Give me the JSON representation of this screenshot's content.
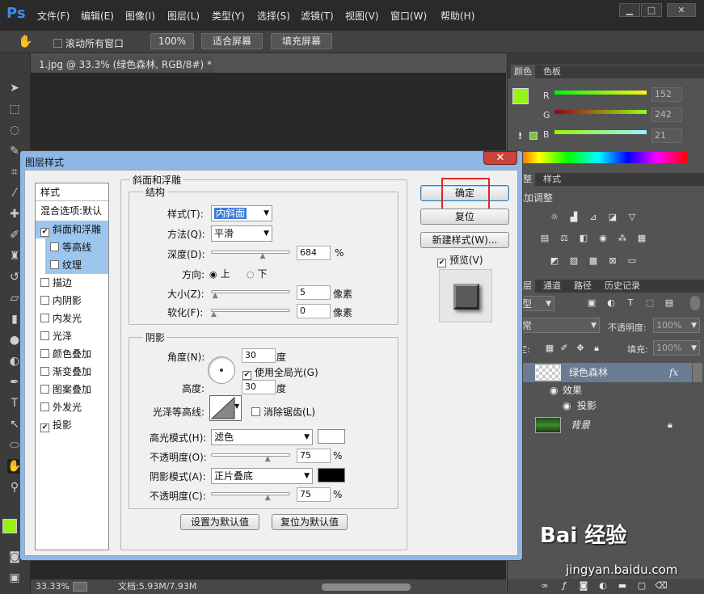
{
  "app": {
    "logo": "Ps"
  },
  "menu": [
    "文件(F)",
    "编辑(E)",
    "图像(I)",
    "图层(L)",
    "类型(Y)",
    "选择(S)",
    "滤镜(T)",
    "视图(V)",
    "窗口(W)",
    "帮助(H)"
  ],
  "window_controls": {
    "min": "▁",
    "max": "□",
    "close": "✕"
  },
  "options": {
    "scroll_all": "滚动所有窗口",
    "zoom100": "100%",
    "fit": "适合屏幕",
    "fill": "填充屏幕"
  },
  "doc": {
    "tab": "1.jpg @ 33.3% (绿色森林, RGB/8#) *",
    "close": "×"
  },
  "status": {
    "zoom": "33.33%",
    "doc": "文档:5.93M/7.93M"
  },
  "color_panel": {
    "tabs": [
      "颜色",
      "色板"
    ],
    "r_label": "R",
    "g_label": "G",
    "b_label": "B",
    "r": "152",
    "g": "242",
    "b": "21",
    "fg": "#98f215",
    "warn": "!"
  },
  "adjust_panel": {
    "tabs": [
      "调整",
      "样式"
    ],
    "title": "添加调整"
  },
  "layers_panel": {
    "tabs": [
      "图层",
      "通道",
      "路径",
      "历史记录"
    ],
    "kind": "类型",
    "blend": "正常",
    "opacity_label": "不透明度:",
    "opacity": "100%",
    "lock_label": "锁定:",
    "fill_label": "填充:",
    "fill": "100%",
    "layers": [
      {
        "name": "绿色森林",
        "fx": "fx"
      },
      {
        "name": "效果"
      },
      {
        "name": "投影"
      },
      {
        "name": "背景"
      }
    ]
  },
  "dialog": {
    "title": "图层样式",
    "close": "✕",
    "list_header": "样式",
    "styles": [
      {
        "label": "混合选项:默认",
        "check": false
      },
      {
        "label": "斜面和浮雕",
        "check": true,
        "sel": true
      },
      {
        "label": "等高线",
        "check": false,
        "sub": true
      },
      {
        "label": "纹理",
        "check": false,
        "sub": true
      },
      {
        "label": "描边",
        "check": false
      },
      {
        "label": "内阴影",
        "check": false
      },
      {
        "label": "内发光",
        "check": false
      },
      {
        "label": "光泽",
        "check": false
      },
      {
        "label": "颜色叠加",
        "check": false
      },
      {
        "label": "渐变叠加",
        "check": false
      },
      {
        "label": "图案叠加",
        "check": false
      },
      {
        "label": "外发光",
        "check": false
      },
      {
        "label": "投影",
        "check": true
      }
    ],
    "group_title": "斜面和浮雕",
    "structure": {
      "title": "结构",
      "style_label": "样式(T):",
      "style_value": "内斜面",
      "method_label": "方法(Q):",
      "method_value": "平滑",
      "depth_label": "深度(D):",
      "depth_value": "684",
      "depth_unit": "%",
      "depth_pos": 0.68,
      "dir_label": "方向:",
      "dir_up": "上",
      "dir_down": "下",
      "size_label": "大小(Z):",
      "size_value": "5",
      "size_unit": "像素",
      "size_pos": 0.02,
      "soften_label": "软化(F):",
      "soften_value": "0",
      "soften_unit": "像素",
      "soften_pos": 0.0
    },
    "shading": {
      "title": "阴影",
      "angle_label": "角度(N):",
      "angle_value": "30",
      "angle_unit": "度",
      "global_label": "使用全局光(G)",
      "altitude_label": "高度:",
      "altitude_value": "30",
      "altitude_unit": "度",
      "gloss_label": "光泽等高线:",
      "antialias_label": "消除锯齿(L)",
      "hl_mode_label": "高光模式(H):",
      "hl_mode_value": "滤色",
      "hl_color": "#ffffff",
      "hl_op_label": "不透明度(O):",
      "hl_op_value": "75",
      "hl_op_unit": "%",
      "hl_op_pos": 0.75,
      "sh_mode_label": "阴影模式(A):",
      "sh_mode_value": "正片叠底",
      "sh_color": "#000000",
      "sh_op_label": "不透明度(C):",
      "sh_op_value": "75",
      "sh_op_unit": "%",
      "sh_op_pos": 0.75
    },
    "set_default": "设置为默认值",
    "reset_default": "复位为默认值",
    "ok": "确定",
    "reset": "复位",
    "new_style": "新建样式(W)...",
    "preview": "预览(V)"
  },
  "watermark": {
    "brand": "Bai 经验",
    "url": "jingyan.baidu.com"
  }
}
